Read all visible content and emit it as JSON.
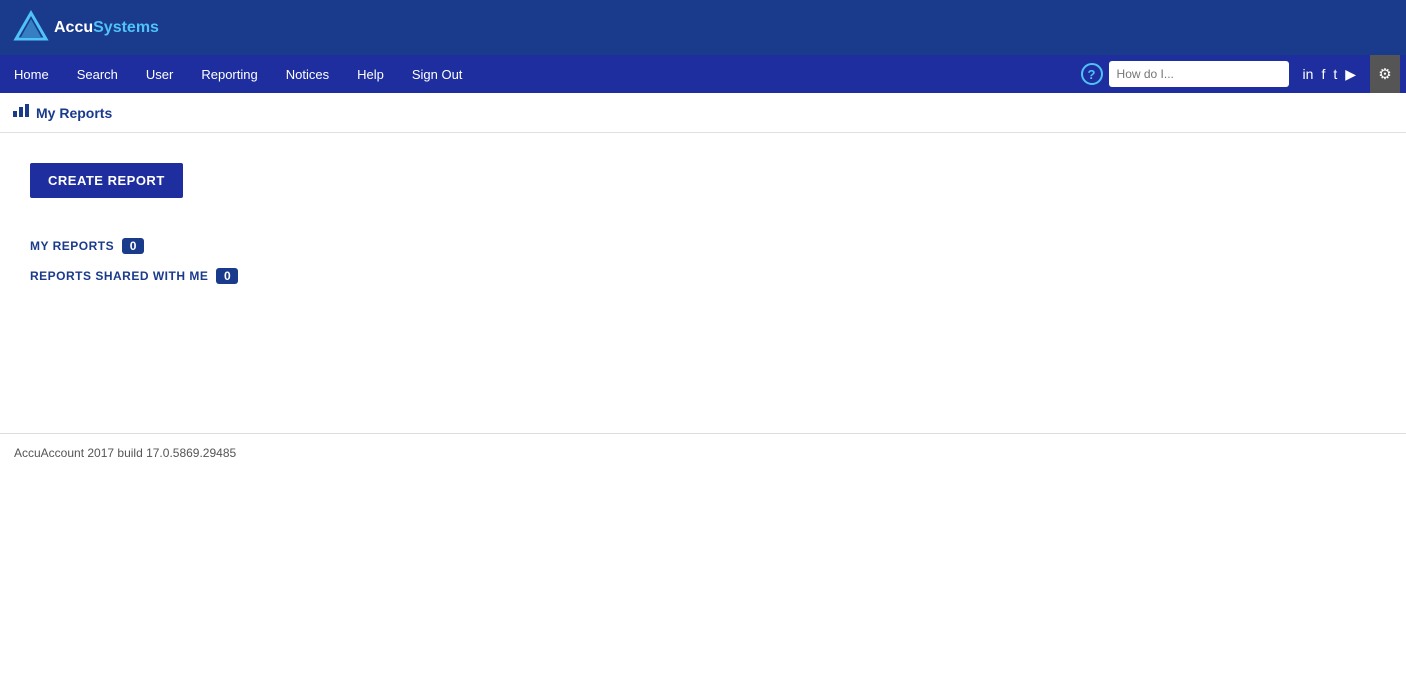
{
  "brand": {
    "name_accu": "Accu",
    "name_systems": "Systems",
    "logo_alt": "AccuSystems Logo"
  },
  "nav": {
    "items": [
      {
        "label": "Home",
        "id": "home"
      },
      {
        "label": "Search",
        "id": "search"
      },
      {
        "label": "User",
        "id": "user"
      },
      {
        "label": "Reporting",
        "id": "reporting"
      },
      {
        "label": "Notices",
        "id": "notices"
      },
      {
        "label": "Help",
        "id": "help"
      },
      {
        "label": "Sign Out",
        "id": "signout"
      }
    ],
    "search_placeholder": "How do I...",
    "help_symbol": "?"
  },
  "social": {
    "linkedin": "in",
    "facebook": "f",
    "twitter": "t",
    "youtube": "▶",
    "settings": "⚙"
  },
  "breadcrumb": {
    "icon": "📊",
    "text": "My Reports"
  },
  "main": {
    "create_button_label": "CREATE REPORT",
    "my_reports_label": "MY REPORTS",
    "my_reports_count": "0",
    "shared_reports_label": "REPORTS SHARED WITH ME",
    "shared_reports_count": "0"
  },
  "footer": {
    "version_text": "AccuAccount 2017 build 17.0.5869.29485"
  }
}
